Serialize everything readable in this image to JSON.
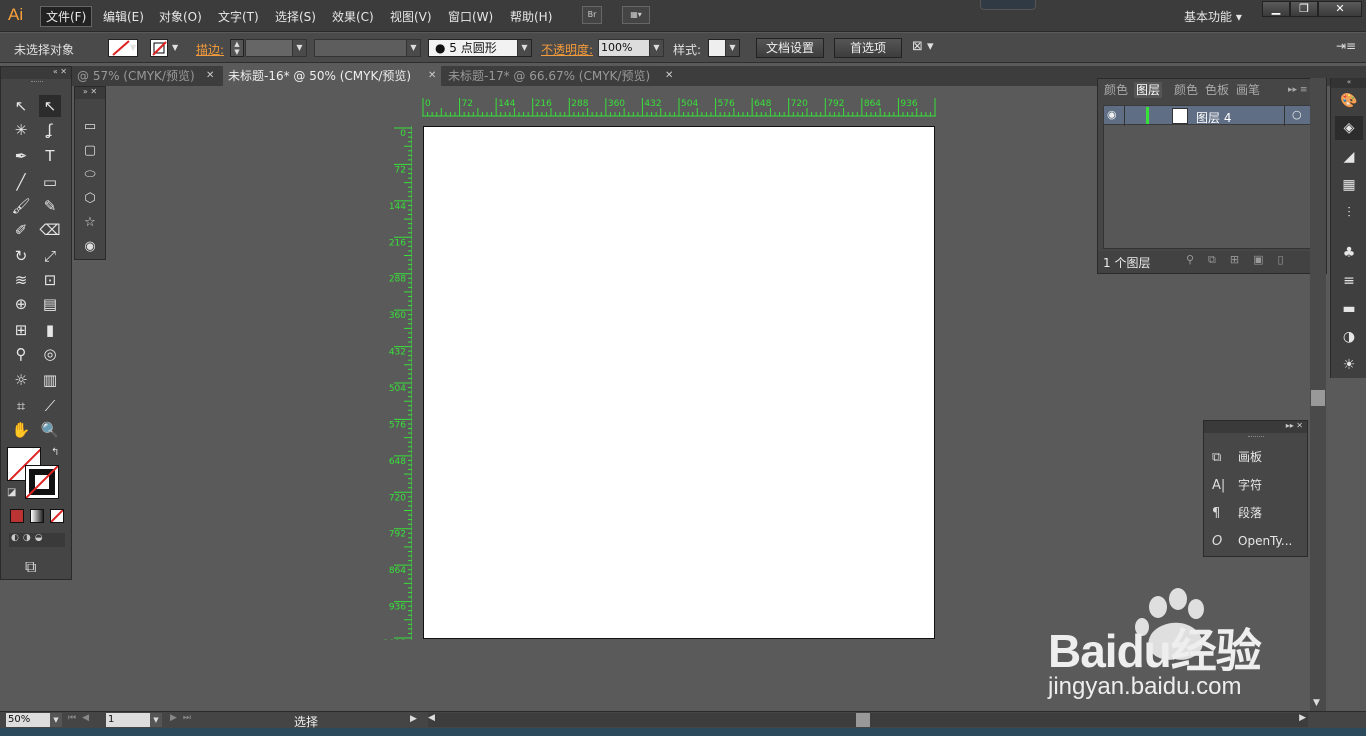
{
  "app": {
    "logo": "Ai"
  },
  "menu": {
    "items": [
      "文件(F)",
      "编辑(E)",
      "对象(O)",
      "文字(T)",
      "选择(S)",
      "效果(C)",
      "视图(V)",
      "窗口(W)",
      "帮助(H)"
    ],
    "bridge": "Br",
    "workspace": "基本功能"
  },
  "control": {
    "selection": "未选择对象",
    "stroke_label": "描边:",
    "brush": "5 点圆形",
    "opacity_label": "不透明度:",
    "opacity_value": "100%",
    "style_label": "样式:",
    "doc_setup": "文档设置",
    "preferences": "首选项"
  },
  "tabs": [
    {
      "label": "@ 57% (CMYK/预览)"
    },
    {
      "label": "未标题-16* @ 50% (CMYK/预览)"
    },
    {
      "label": "未标题-17* @ 66.67% (CMYK/预览)"
    }
  ],
  "ruler": {
    "h_ticks": [
      "0",
      "72",
      "144",
      "216",
      "288",
      "360",
      "432",
      "504",
      "576",
      "648",
      "720",
      "792",
      "864",
      "936",
      "1008"
    ],
    "v_ticks": [
      "0",
      "72",
      "144",
      "216",
      "288",
      "360",
      "432",
      "504",
      "576",
      "648",
      "720",
      "792",
      "864",
      "936",
      "1008"
    ]
  },
  "layers": {
    "tabs": [
      "颜色",
      "图层",
      "颜色",
      "色板",
      "画笔"
    ],
    "rows": [
      {
        "name": "图层 4"
      }
    ],
    "count": "1 个图层"
  },
  "floatpanel": {
    "items": [
      {
        "icon": "artboard-icon",
        "label": "画板"
      },
      {
        "icon": "character-icon",
        "label": "字符"
      },
      {
        "icon": "paragraph-icon",
        "label": "段落"
      },
      {
        "icon": "opentype-icon",
        "label": "OpenTy..."
      }
    ]
  },
  "status": {
    "zoom": "50%",
    "artboard": "1",
    "tool": "选择"
  },
  "watermark": {
    "brand": "Baidu经验",
    "url": "jingyan.baidu.com"
  },
  "colors": {
    "accent": "#f39b3a",
    "ruler": "#38e03a",
    "layer_highlight": "#5f6e84"
  }
}
